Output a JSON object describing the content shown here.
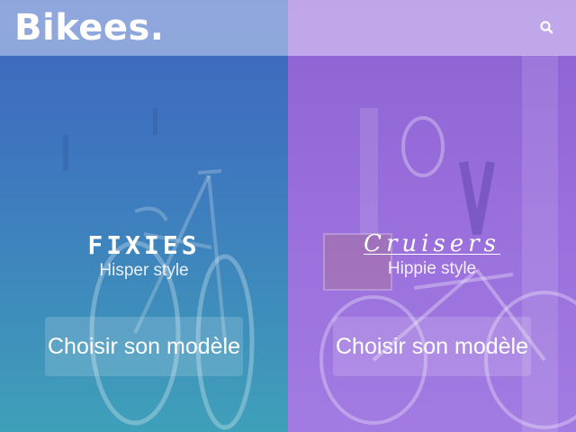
{
  "header": {
    "logo_text": "Bikees.",
    "search_icon": "search-icon"
  },
  "categories": [
    {
      "title": "FIXIES",
      "subtitle": "Hisper style",
      "button_label": "Choisir son modèle",
      "overlay_color": "#3f6fbd"
    },
    {
      "title": "Cruisers",
      "subtitle": "Hippie style",
      "button_label": "Choisir son modèle",
      "overlay_color": "#9568d8"
    }
  ]
}
